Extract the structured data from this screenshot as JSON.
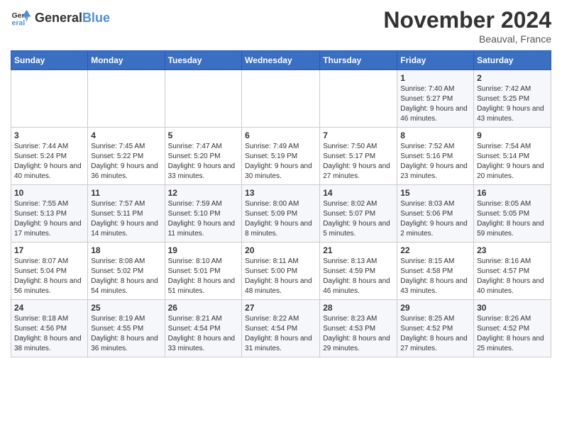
{
  "header": {
    "logo_general": "General",
    "logo_blue": "Blue",
    "month_title": "November 2024",
    "location": "Beauval, France"
  },
  "days_of_week": [
    "Sunday",
    "Monday",
    "Tuesday",
    "Wednesday",
    "Thursday",
    "Friday",
    "Saturday"
  ],
  "weeks": [
    [
      {
        "day": "",
        "info": ""
      },
      {
        "day": "",
        "info": ""
      },
      {
        "day": "",
        "info": ""
      },
      {
        "day": "",
        "info": ""
      },
      {
        "day": "",
        "info": ""
      },
      {
        "day": "1",
        "info": "Sunrise: 7:40 AM\nSunset: 5:27 PM\nDaylight: 9 hours and 46 minutes."
      },
      {
        "day": "2",
        "info": "Sunrise: 7:42 AM\nSunset: 5:25 PM\nDaylight: 9 hours and 43 minutes."
      }
    ],
    [
      {
        "day": "3",
        "info": "Sunrise: 7:44 AM\nSunset: 5:24 PM\nDaylight: 9 hours and 40 minutes."
      },
      {
        "day": "4",
        "info": "Sunrise: 7:45 AM\nSunset: 5:22 PM\nDaylight: 9 hours and 36 minutes."
      },
      {
        "day": "5",
        "info": "Sunrise: 7:47 AM\nSunset: 5:20 PM\nDaylight: 9 hours and 33 minutes."
      },
      {
        "day": "6",
        "info": "Sunrise: 7:49 AM\nSunset: 5:19 PM\nDaylight: 9 hours and 30 minutes."
      },
      {
        "day": "7",
        "info": "Sunrise: 7:50 AM\nSunset: 5:17 PM\nDaylight: 9 hours and 27 minutes."
      },
      {
        "day": "8",
        "info": "Sunrise: 7:52 AM\nSunset: 5:16 PM\nDaylight: 9 hours and 23 minutes."
      },
      {
        "day": "9",
        "info": "Sunrise: 7:54 AM\nSunset: 5:14 PM\nDaylight: 9 hours and 20 minutes."
      }
    ],
    [
      {
        "day": "10",
        "info": "Sunrise: 7:55 AM\nSunset: 5:13 PM\nDaylight: 9 hours and 17 minutes."
      },
      {
        "day": "11",
        "info": "Sunrise: 7:57 AM\nSunset: 5:11 PM\nDaylight: 9 hours and 14 minutes."
      },
      {
        "day": "12",
        "info": "Sunrise: 7:59 AM\nSunset: 5:10 PM\nDaylight: 9 hours and 11 minutes."
      },
      {
        "day": "13",
        "info": "Sunrise: 8:00 AM\nSunset: 5:09 PM\nDaylight: 9 hours and 8 minutes."
      },
      {
        "day": "14",
        "info": "Sunrise: 8:02 AM\nSunset: 5:07 PM\nDaylight: 9 hours and 5 minutes."
      },
      {
        "day": "15",
        "info": "Sunrise: 8:03 AM\nSunset: 5:06 PM\nDaylight: 9 hours and 2 minutes."
      },
      {
        "day": "16",
        "info": "Sunrise: 8:05 AM\nSunset: 5:05 PM\nDaylight: 8 hours and 59 minutes."
      }
    ],
    [
      {
        "day": "17",
        "info": "Sunrise: 8:07 AM\nSunset: 5:04 PM\nDaylight: 8 hours and 56 minutes."
      },
      {
        "day": "18",
        "info": "Sunrise: 8:08 AM\nSunset: 5:02 PM\nDaylight: 8 hours and 54 minutes."
      },
      {
        "day": "19",
        "info": "Sunrise: 8:10 AM\nSunset: 5:01 PM\nDaylight: 8 hours and 51 minutes."
      },
      {
        "day": "20",
        "info": "Sunrise: 8:11 AM\nSunset: 5:00 PM\nDaylight: 8 hours and 48 minutes."
      },
      {
        "day": "21",
        "info": "Sunrise: 8:13 AM\nSunset: 4:59 PM\nDaylight: 8 hours and 46 minutes."
      },
      {
        "day": "22",
        "info": "Sunrise: 8:15 AM\nSunset: 4:58 PM\nDaylight: 8 hours and 43 minutes."
      },
      {
        "day": "23",
        "info": "Sunrise: 8:16 AM\nSunset: 4:57 PM\nDaylight: 8 hours and 40 minutes."
      }
    ],
    [
      {
        "day": "24",
        "info": "Sunrise: 8:18 AM\nSunset: 4:56 PM\nDaylight: 8 hours and 38 minutes."
      },
      {
        "day": "25",
        "info": "Sunrise: 8:19 AM\nSunset: 4:55 PM\nDaylight: 8 hours and 36 minutes."
      },
      {
        "day": "26",
        "info": "Sunrise: 8:21 AM\nSunset: 4:54 PM\nDaylight: 8 hours and 33 minutes."
      },
      {
        "day": "27",
        "info": "Sunrise: 8:22 AM\nSunset: 4:54 PM\nDaylight: 8 hours and 31 minutes."
      },
      {
        "day": "28",
        "info": "Sunrise: 8:23 AM\nSunset: 4:53 PM\nDaylight: 8 hours and 29 minutes."
      },
      {
        "day": "29",
        "info": "Sunrise: 8:25 AM\nSunset: 4:52 PM\nDaylight: 8 hours and 27 minutes."
      },
      {
        "day": "30",
        "info": "Sunrise: 8:26 AM\nSunset: 4:52 PM\nDaylight: 8 hours and 25 minutes."
      }
    ]
  ]
}
